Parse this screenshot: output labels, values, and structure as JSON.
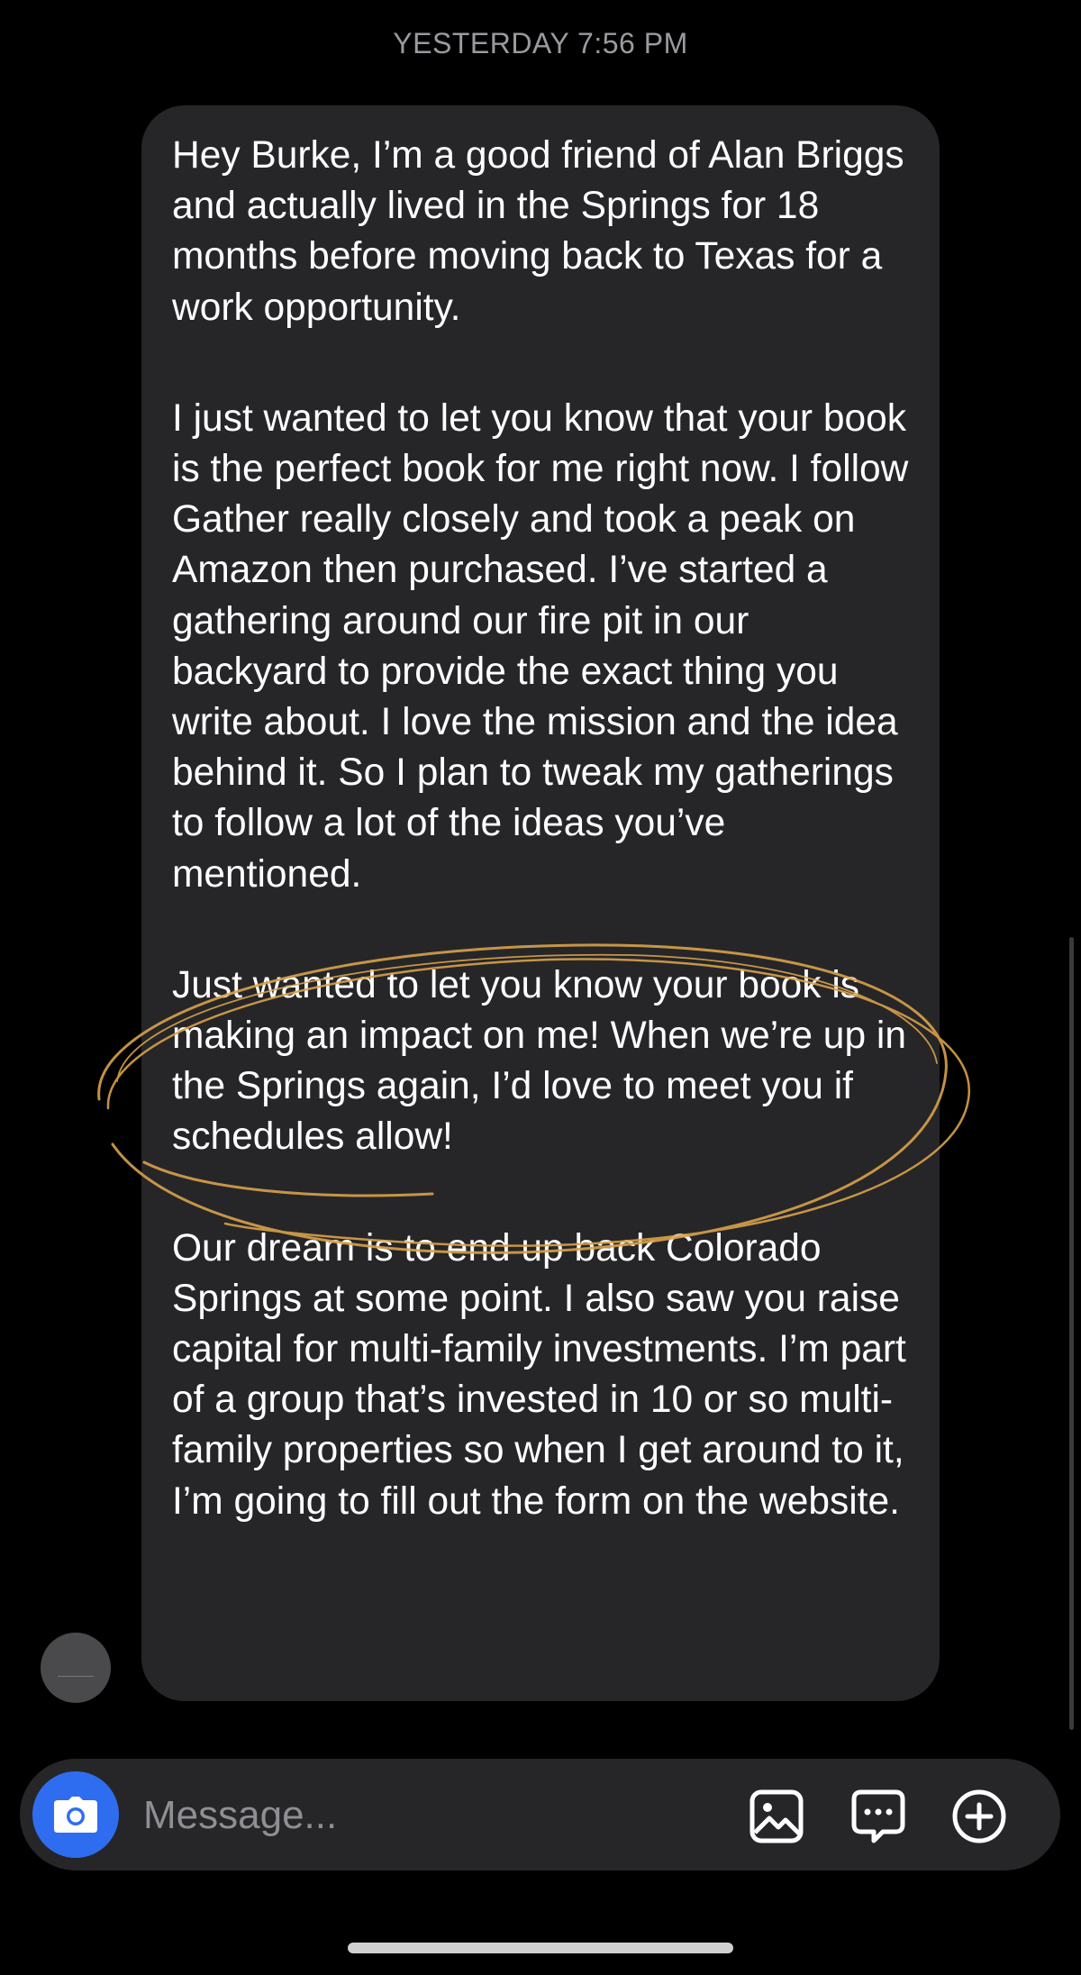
{
  "timestamp": "YESTERDAY 7:56 PM",
  "message": {
    "paragraphs": [
      "Hey Burke, I’m a good friend of Alan Briggs and actually lived in the Springs for 18 months before moving back to Texas for a work opportunity.",
      "I just wanted to let you know that your book is the perfect book for me right now. I follow Gather really closely and took a peak on Amazon then purchased. I’ve started a gathering around our fire pit in our backyard to provide the exact thing you write about. I love the mission and the idea behind it. So I plan to tweak my gatherings to follow a lot of the ideas you’ve mentioned.",
      "Just wanted to let you know your book is making an impact on me! When we’re up in the Springs again, I’d love to meet you if schedules allow!",
      "Our dream is to end up back Colorado Springs at some point. I also saw you raise capital for multi-family investments. I’m part of a group that’s invested in 10 or so multi-family properties so when I get around to it, I’m going to fill out the form on the website."
    ]
  },
  "composer": {
    "placeholder": "Message...",
    "icons": [
      "camera-icon",
      "gallery-icon",
      "sticker-chat-icon",
      "add-icon"
    ],
    "camera_color": "#2f6df0"
  },
  "colors": {
    "background": "#000000",
    "bubble": "#262629",
    "annotation": "#d9a24a"
  }
}
